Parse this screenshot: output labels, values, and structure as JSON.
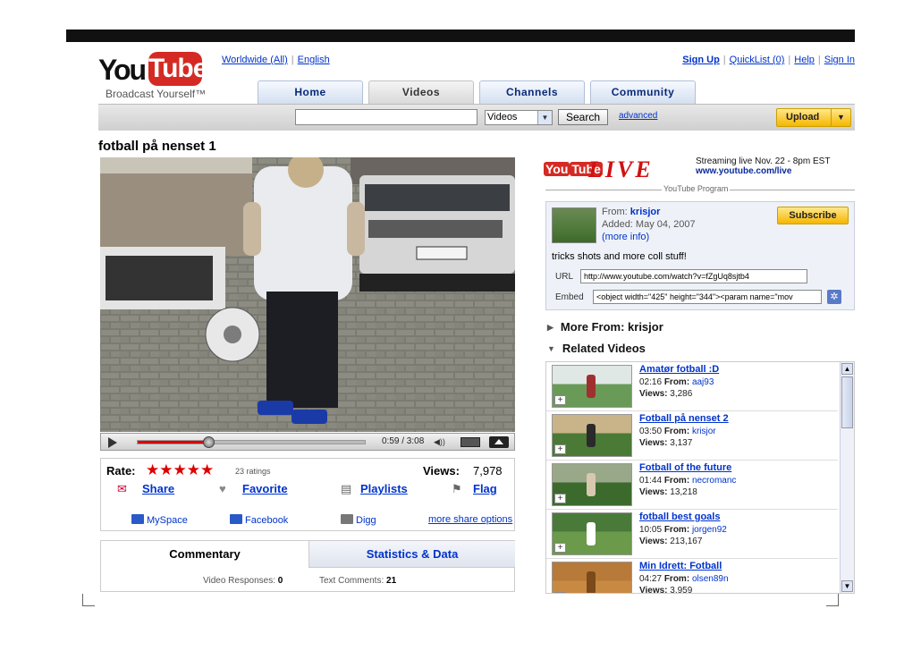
{
  "header": {
    "logo_you": "You",
    "logo_tube": "Tube",
    "tagline": "Broadcast Yourself™",
    "region": "Worldwide (All)",
    "language": "English",
    "user_links": [
      "Sign Up",
      "QuickList (0)",
      "Help",
      "Sign In"
    ]
  },
  "nav": {
    "tabs": [
      "Home",
      "Videos",
      "Channels",
      "Community"
    ]
  },
  "search": {
    "placeholder": "",
    "category": "Videos",
    "button": "Search",
    "advanced": "advanced",
    "upload": "Upload"
  },
  "video": {
    "title": "fotball på nenset 1",
    "time": "0:59 / 3:08",
    "progress": 0.31
  },
  "rating": {
    "rate_label": "Rate:",
    "stars": "★★★★★",
    "ratings_count": "23 ratings",
    "views_label": "Views:",
    "views": "7,978",
    "actions": [
      "Share",
      "Favorite",
      "Playlists",
      "Flag"
    ],
    "share_links": [
      "MySpace",
      "Facebook",
      "Digg"
    ],
    "more_share": "more share options"
  },
  "commentary": {
    "tab_commentary": "Commentary",
    "tab_stats": "Statistics & Data",
    "responses_label": "Video Responses:",
    "responses": "0",
    "comments_label": "Text Comments:",
    "comments": "21"
  },
  "live": {
    "yt": "You",
    "yt_tube": "Tube",
    "live": "LIVE",
    "line1": "Streaming live Nov. 22 - 8pm EST",
    "line2": "www.youtube.com/live",
    "program": "YouTube Program"
  },
  "channel": {
    "from_label": "From:",
    "from_user": "krisjor",
    "added": "Added: May 04, 2007",
    "more_info": "(more info)",
    "subscribe": "Subscribe",
    "description": "tricks shots and more coll stuff!",
    "url_label": "URL",
    "url": "http://www.youtube.com/watch?v=fZgUq8sjtb4",
    "embed_label": "Embed",
    "embed": "<object width=\"425\" height=\"344\"><param name=\"mov"
  },
  "sections": {
    "more_from": "More From: krisjor",
    "related": "Related Videos"
  },
  "related": [
    {
      "title": "Amatør fotball :D",
      "duration": "02:16",
      "user": "aaj93",
      "views": "3,286",
      "palette": "red"
    },
    {
      "title": "Fotball på nenset 2",
      "duration": "03:50",
      "user": "krisjor",
      "views": "3,137",
      "palette": "yard"
    },
    {
      "title": "Fotball of the future",
      "duration": "01:44",
      "user": "necromanc",
      "views": "13,218",
      "palette": "yard2"
    },
    {
      "title": "fotball best goals",
      "duration": "10:05",
      "user": "jorgen92",
      "views": "213,167",
      "palette": "pitch"
    },
    {
      "title": "Min Idrett: Fotball",
      "duration": "04:27",
      "user": "olsen89n",
      "views": "3,959",
      "palette": "indoor"
    }
  ],
  "labels": {
    "from": "From:",
    "views": "Views:"
  }
}
